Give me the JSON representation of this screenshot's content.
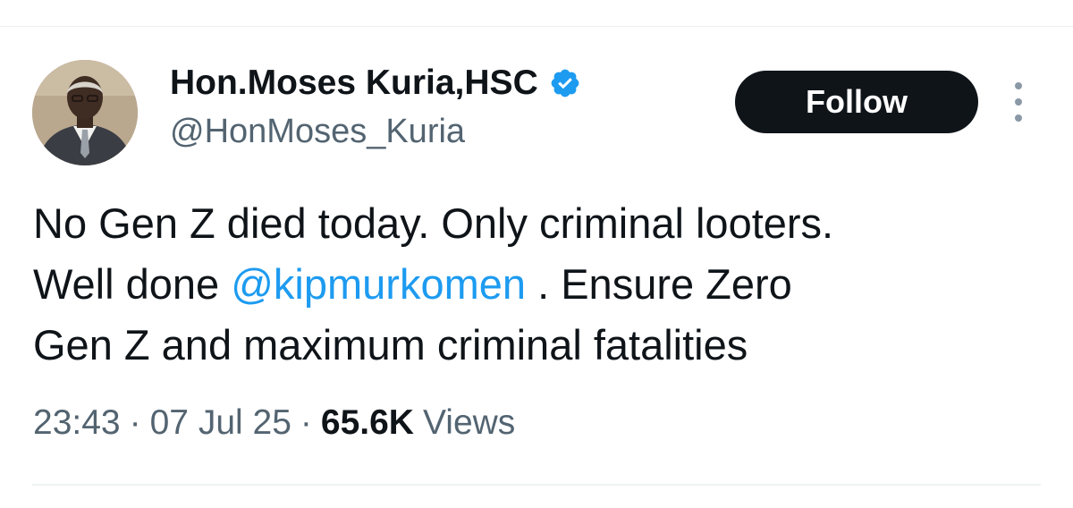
{
  "author": {
    "display_name": "Hon.Moses Kuria,HSC",
    "handle": "@HonMoses_Kuria",
    "verified_icon": "verified-badge-icon",
    "verified_color": "#1d9bf0",
    "avatar": "profile-photo"
  },
  "actions": {
    "follow_label": "Follow",
    "more_icon": "more-options-icon"
  },
  "tweet": {
    "line1": "No Gen Z died today. Only criminal looters.",
    "line2_before": "Well done ",
    "line2_mention": "@kipmurkomen",
    "line2_after": " . Ensure Zero",
    "line3": "Gen Z and maximum criminal fatalities"
  },
  "meta": {
    "time": "23:43",
    "separator": "·",
    "date": "07 Jul 25",
    "views_count": "65.6K",
    "views_label": "Views"
  },
  "colors": {
    "text": "#0f1419",
    "secondary": "#536471",
    "link": "#1d9bf0",
    "button_bg": "#0f1419",
    "button_text": "#ffffff"
  }
}
